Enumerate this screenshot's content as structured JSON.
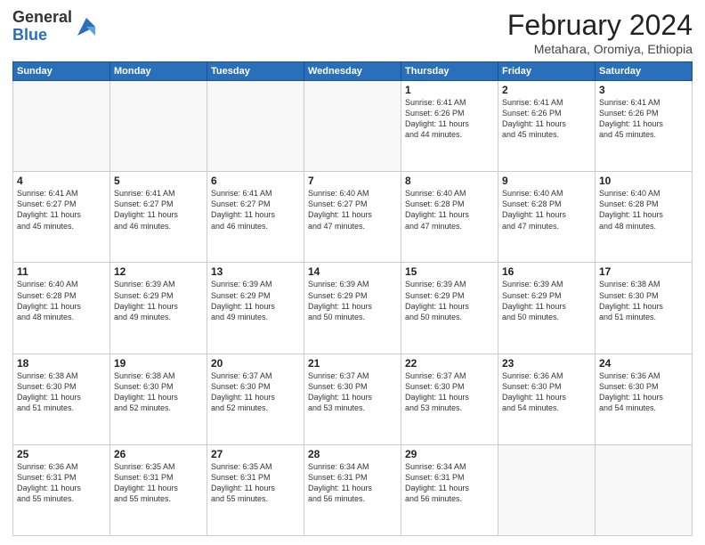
{
  "logo": {
    "general": "General",
    "blue": "Blue"
  },
  "title": "February 2024",
  "subtitle": "Metahara, Oromiya, Ethiopia",
  "days_of_week": [
    "Sunday",
    "Monday",
    "Tuesday",
    "Wednesday",
    "Thursday",
    "Friday",
    "Saturday"
  ],
  "weeks": [
    [
      {
        "day": "",
        "info": ""
      },
      {
        "day": "",
        "info": ""
      },
      {
        "day": "",
        "info": ""
      },
      {
        "day": "",
        "info": ""
      },
      {
        "day": "1",
        "info": "Sunrise: 6:41 AM\nSunset: 6:26 PM\nDaylight: 11 hours\nand 44 minutes."
      },
      {
        "day": "2",
        "info": "Sunrise: 6:41 AM\nSunset: 6:26 PM\nDaylight: 11 hours\nand 45 minutes."
      },
      {
        "day": "3",
        "info": "Sunrise: 6:41 AM\nSunset: 6:26 PM\nDaylight: 11 hours\nand 45 minutes."
      }
    ],
    [
      {
        "day": "4",
        "info": "Sunrise: 6:41 AM\nSunset: 6:27 PM\nDaylight: 11 hours\nand 45 minutes."
      },
      {
        "day": "5",
        "info": "Sunrise: 6:41 AM\nSunset: 6:27 PM\nDaylight: 11 hours\nand 46 minutes."
      },
      {
        "day": "6",
        "info": "Sunrise: 6:41 AM\nSunset: 6:27 PM\nDaylight: 11 hours\nand 46 minutes."
      },
      {
        "day": "7",
        "info": "Sunrise: 6:40 AM\nSunset: 6:27 PM\nDaylight: 11 hours\nand 47 minutes."
      },
      {
        "day": "8",
        "info": "Sunrise: 6:40 AM\nSunset: 6:28 PM\nDaylight: 11 hours\nand 47 minutes."
      },
      {
        "day": "9",
        "info": "Sunrise: 6:40 AM\nSunset: 6:28 PM\nDaylight: 11 hours\nand 47 minutes."
      },
      {
        "day": "10",
        "info": "Sunrise: 6:40 AM\nSunset: 6:28 PM\nDaylight: 11 hours\nand 48 minutes."
      }
    ],
    [
      {
        "day": "11",
        "info": "Sunrise: 6:40 AM\nSunset: 6:28 PM\nDaylight: 11 hours\nand 48 minutes."
      },
      {
        "day": "12",
        "info": "Sunrise: 6:39 AM\nSunset: 6:29 PM\nDaylight: 11 hours\nand 49 minutes."
      },
      {
        "day": "13",
        "info": "Sunrise: 6:39 AM\nSunset: 6:29 PM\nDaylight: 11 hours\nand 49 minutes."
      },
      {
        "day": "14",
        "info": "Sunrise: 6:39 AM\nSunset: 6:29 PM\nDaylight: 11 hours\nand 50 minutes."
      },
      {
        "day": "15",
        "info": "Sunrise: 6:39 AM\nSunset: 6:29 PM\nDaylight: 11 hours\nand 50 minutes."
      },
      {
        "day": "16",
        "info": "Sunrise: 6:39 AM\nSunset: 6:29 PM\nDaylight: 11 hours\nand 50 minutes."
      },
      {
        "day": "17",
        "info": "Sunrise: 6:38 AM\nSunset: 6:30 PM\nDaylight: 11 hours\nand 51 minutes."
      }
    ],
    [
      {
        "day": "18",
        "info": "Sunrise: 6:38 AM\nSunset: 6:30 PM\nDaylight: 11 hours\nand 51 minutes."
      },
      {
        "day": "19",
        "info": "Sunrise: 6:38 AM\nSunset: 6:30 PM\nDaylight: 11 hours\nand 52 minutes."
      },
      {
        "day": "20",
        "info": "Sunrise: 6:37 AM\nSunset: 6:30 PM\nDaylight: 11 hours\nand 52 minutes."
      },
      {
        "day": "21",
        "info": "Sunrise: 6:37 AM\nSunset: 6:30 PM\nDaylight: 11 hours\nand 53 minutes."
      },
      {
        "day": "22",
        "info": "Sunrise: 6:37 AM\nSunset: 6:30 PM\nDaylight: 11 hours\nand 53 minutes."
      },
      {
        "day": "23",
        "info": "Sunrise: 6:36 AM\nSunset: 6:30 PM\nDaylight: 11 hours\nand 54 minutes."
      },
      {
        "day": "24",
        "info": "Sunrise: 6:36 AM\nSunset: 6:30 PM\nDaylight: 11 hours\nand 54 minutes."
      }
    ],
    [
      {
        "day": "25",
        "info": "Sunrise: 6:36 AM\nSunset: 6:31 PM\nDaylight: 11 hours\nand 55 minutes."
      },
      {
        "day": "26",
        "info": "Sunrise: 6:35 AM\nSunset: 6:31 PM\nDaylight: 11 hours\nand 55 minutes."
      },
      {
        "day": "27",
        "info": "Sunrise: 6:35 AM\nSunset: 6:31 PM\nDaylight: 11 hours\nand 55 minutes."
      },
      {
        "day": "28",
        "info": "Sunrise: 6:34 AM\nSunset: 6:31 PM\nDaylight: 11 hours\nand 56 minutes."
      },
      {
        "day": "29",
        "info": "Sunrise: 6:34 AM\nSunset: 6:31 PM\nDaylight: 11 hours\nand 56 minutes."
      },
      {
        "day": "",
        "info": ""
      },
      {
        "day": "",
        "info": ""
      }
    ]
  ]
}
